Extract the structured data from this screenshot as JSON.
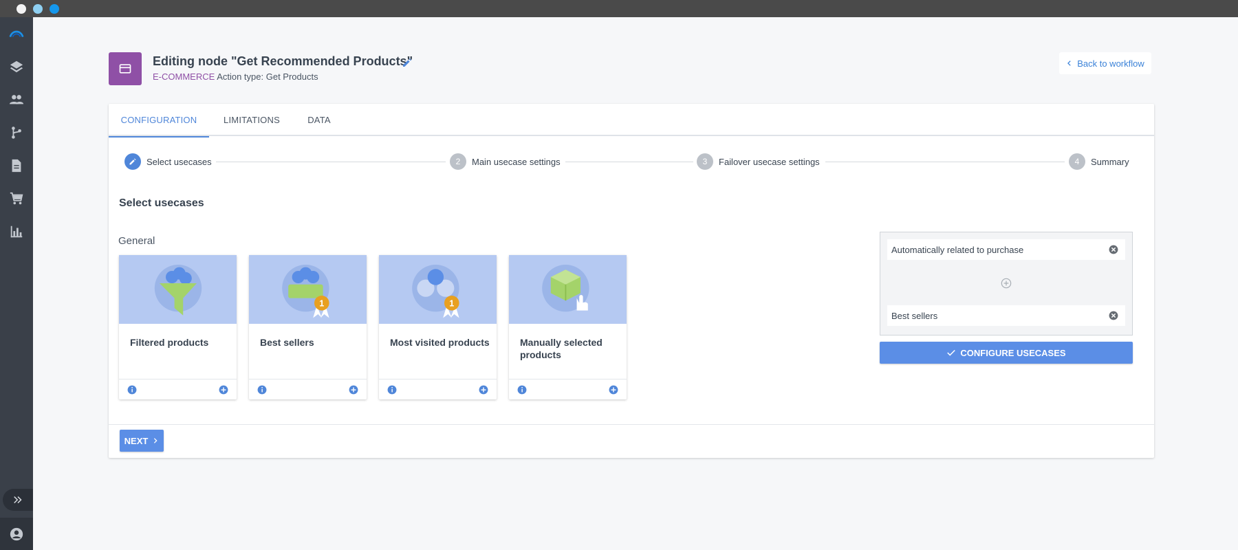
{
  "header": {
    "title": "Editing node \"Get Recommended Products\"",
    "category": "E-COMMERCE",
    "action_type": "Action type: Get Products",
    "back_label": "Back to workflow"
  },
  "tabs": [
    {
      "label": "CONFIGURATION",
      "active": true
    },
    {
      "label": "LIMITATIONS",
      "active": false
    },
    {
      "label": "DATA",
      "active": false
    }
  ],
  "steps": [
    {
      "number": "",
      "label": "Select usecases",
      "active": true
    },
    {
      "number": "2",
      "label": "Main usecase settings",
      "active": false
    },
    {
      "number": "3",
      "label": "Failover usecase settings",
      "active": false
    },
    {
      "number": "4",
      "label": "Summary",
      "active": false
    }
  ],
  "content": {
    "section_title": "Select usecases",
    "group_label": "General",
    "cards": [
      {
        "title": "Filtered products",
        "icon": "funnel-icon"
      },
      {
        "title": "Best sellers",
        "icon": "basket-badge-icon"
      },
      {
        "title": "Most visited products",
        "icon": "boxes-badge-icon"
      },
      {
        "title": "Manually selected products",
        "icon": "box-hand-icon"
      }
    ]
  },
  "selected": {
    "items": [
      "Automatically related to purchase",
      "Best sellers"
    ],
    "configure_label": "CONFIGURE USECASES"
  },
  "footer": {
    "next_label": "NEXT"
  },
  "colors": {
    "accent": "#4f86d9",
    "node_icon": "#8f50a6",
    "sidebar": "#3a4049"
  }
}
